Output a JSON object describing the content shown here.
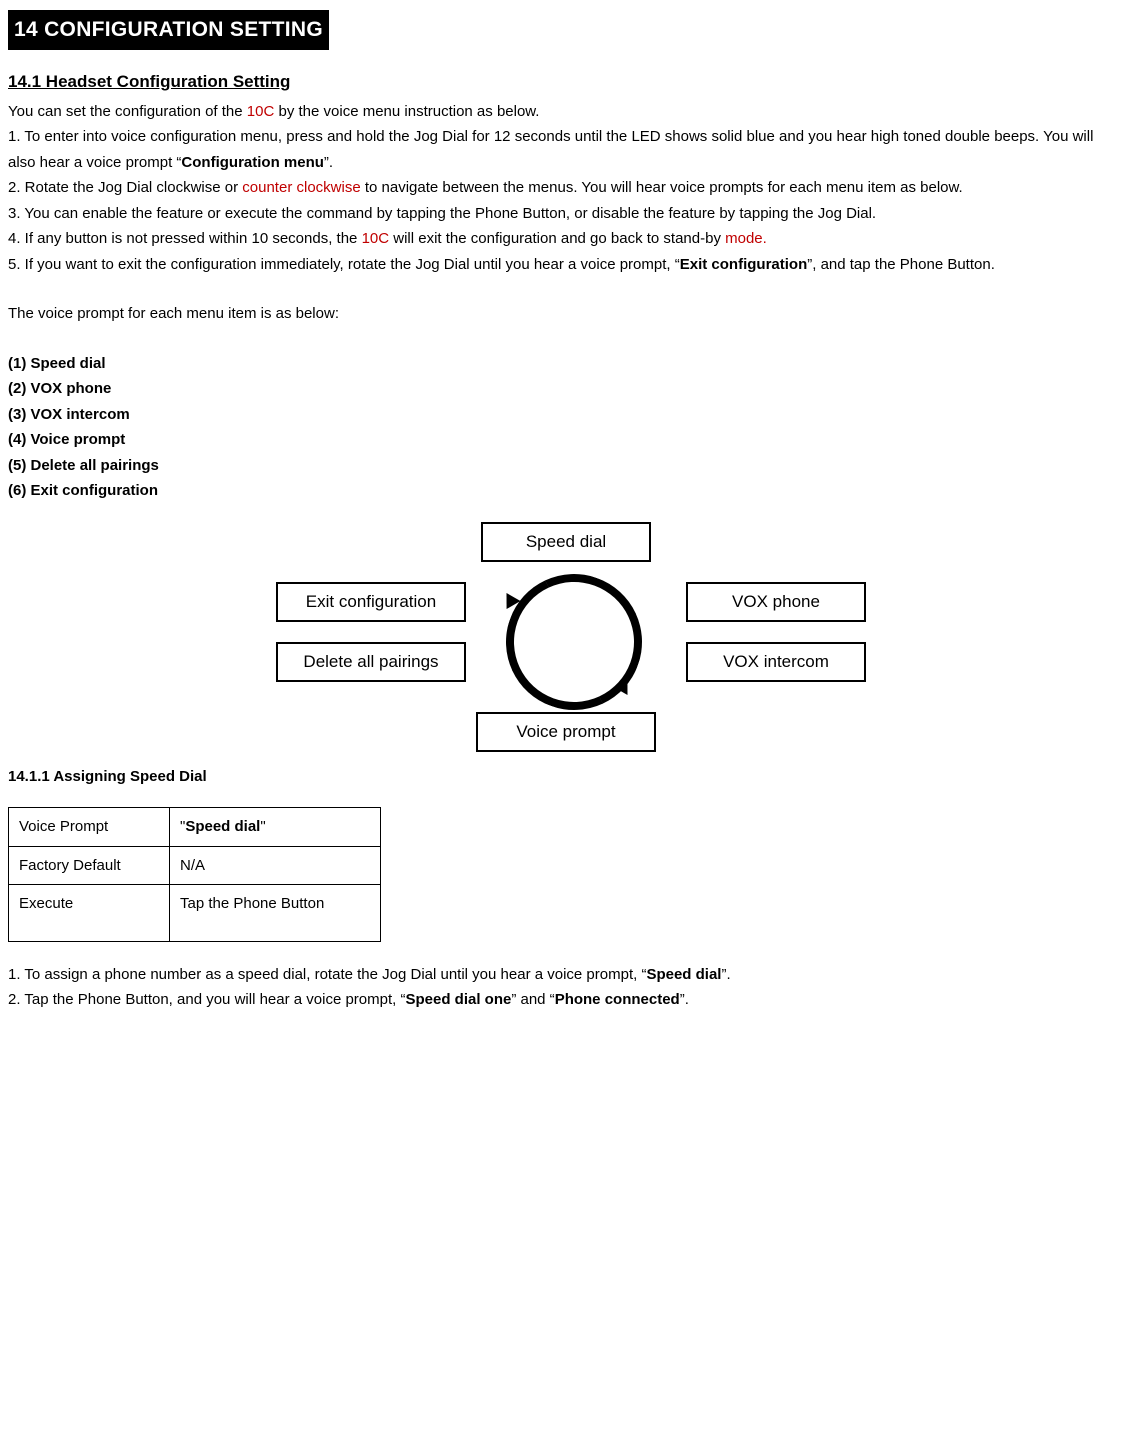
{
  "section_title": "14 CONFIGURATION SETTING",
  "sub_title": "14.1 Headset Configuration Setting",
  "intro": {
    "t1": "You can set the configuration of the ",
    "red1": "10C",
    "t2": " by the voice menu instruction as below."
  },
  "step1": {
    "t1": "1. To enter into voice configuration menu, press and hold the Jog Dial for 12 seconds until the LED shows solid blue and you hear high toned double beeps. You will also hear a voice prompt “",
    "b1": "Configuration menu",
    "t2": "”."
  },
  "step2": {
    "t1": "2. Rotate the Jog Dial clockwise or ",
    "red1": "counter clockwise",
    "t2": " to navigate between the menus. You will hear voice prompts for each menu item as below."
  },
  "step3": "3. You can enable the feature or execute the command by tapping the Phone Button, or disable the feature by tapping the Jog Dial.",
  "step4": {
    "t1": "4. If any button is not pressed within 10 seconds, the ",
    "red1": "10C",
    "t2": " will exit the configuration and go back to stand-by ",
    "red2": "mode."
  },
  "step5": {
    "t1": "5. If you want to exit the configuration immediately, rotate the Jog Dial until you hear a voice prompt, “",
    "b1": "Exit configuration",
    "t2": "”, and tap the Phone Button."
  },
  "prompt_lead": "The voice prompt for each menu item is as below:",
  "items": {
    "i1": "(1) Speed dial",
    "i2": "(2) VOX phone",
    "i3": "(3) VOX intercom",
    "i4": "(4) Voice prompt",
    "i5": "(5) Delete all pairings",
    "i6": "(6) Exit configuration"
  },
  "diagram": {
    "top": "Speed dial",
    "tl": "Exit configuration",
    "tr": "VOX phone",
    "bl": "Delete all pairings",
    "br": "VOX intercom",
    "bot": "Voice prompt"
  },
  "subsub_title": "14.1.1 Assigning Speed Dial",
  "table": {
    "r1c1": "Voice Prompt",
    "r1c2_q1": "\"",
    "r1c2_b": "Speed dial",
    "r1c2_q2": "\"",
    "r2c1": "Factory Default",
    "r2c2": "N/A",
    "r3c1": "Execute",
    "r3c2": "Tap the Phone Button"
  },
  "assign1": {
    "t1": "1. To assign a phone number as a speed dial, rotate the Jog Dial until you hear a voice prompt, “",
    "b1": "Speed dial",
    "t2": "”."
  },
  "assign2": {
    "t1": "2. Tap the Phone Button, and you will hear a voice prompt, “",
    "b1": "Speed dial one",
    "t2": "” and “",
    "b2": "Phone connected",
    "t3": "”."
  }
}
